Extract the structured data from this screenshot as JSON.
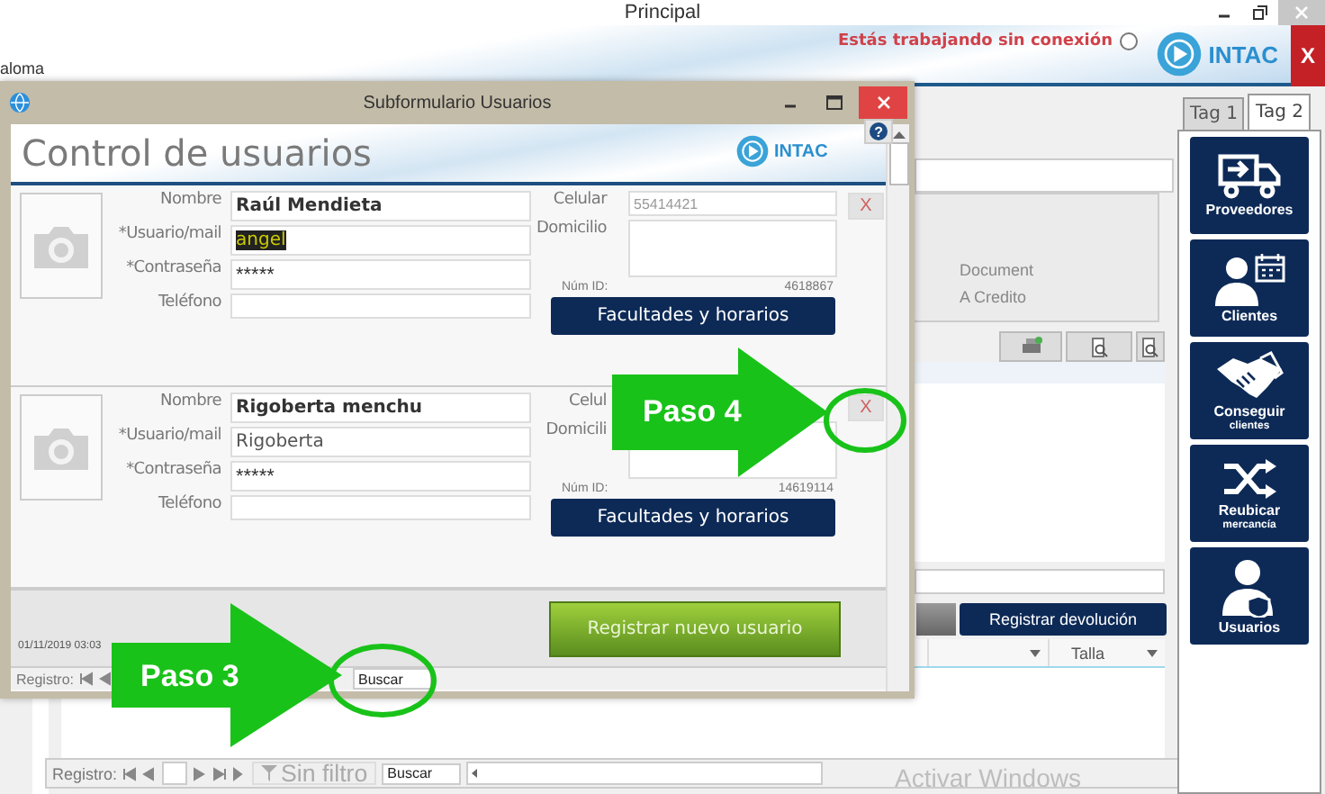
{
  "window": {
    "title": "Principal"
  },
  "header": {
    "user_label": "aloma",
    "offline_status": "Estás trabajando sin conexión",
    "status_radio_checked": false,
    "logo_text": "INTAC",
    "close_label": "X"
  },
  "side_panel": {
    "tabs": [
      {
        "label": "Tag 1",
        "selected": false
      },
      {
        "label": "Tag 2",
        "selected": true
      }
    ],
    "buttons": [
      {
        "kind": "truck",
        "label": "Proveedores"
      },
      {
        "kind": "client",
        "label": "Clientes"
      },
      {
        "kind": "handshake",
        "label": "Conseguir",
        "sublabel": "clientes"
      },
      {
        "kind": "shuffle",
        "label": "Reubicar",
        "sublabel": "mercancía"
      },
      {
        "kind": "user",
        "label": "Usuarios"
      }
    ]
  },
  "main": {
    "document_labels": [
      "Document",
      "A Credito"
    ],
    "return_button": "Registrar devolución",
    "table": {
      "columns": [
        {
          "label": "Talla"
        }
      ]
    },
    "nav": {
      "label": "Registro:",
      "filter": "Sin filtro",
      "search": "Buscar"
    },
    "activation_notice": "Activar Windows"
  },
  "subform": {
    "title": "Subformulario Usuarios",
    "heading": "Control de usuarios",
    "logo_text": "INTAC",
    "help": "?",
    "users": [
      {
        "labels": {
          "name": "Nombre",
          "user": "*Usuario/mail",
          "password": "*Contraseña",
          "phone": "Teléfono",
          "cell": "Celular",
          "address": "Domicilio",
          "id": "Núm ID:"
        },
        "name": "Raúl Mendieta",
        "user": "angel",
        "user_highlighted": true,
        "password": "*****",
        "cell": "55414421",
        "id": "4618867",
        "rights_button": "Facultades y horarios",
        "delete": "X"
      },
      {
        "labels": {
          "name": "Nombre",
          "user": "*Usuario/mail",
          "password": "*Contraseña",
          "phone": "Teléfono",
          "cell": "Celul",
          "address": "Domicili",
          "id": "Núm ID:"
        },
        "name": "Rigoberta menchu",
        "user": "Rigoberta",
        "user_highlighted": false,
        "password": "*****",
        "id": "14619114",
        "rights_button": "Facultades y horarios",
        "delete": "X"
      }
    ],
    "timestamp": "01/11/2019 03:03",
    "register_button": "Registrar nuevo usuario",
    "nav": {
      "label": "Registro:",
      "search": "Buscar"
    }
  },
  "annotations": [
    {
      "label": "Paso 4"
    },
    {
      "label": "Paso 3"
    }
  ]
}
